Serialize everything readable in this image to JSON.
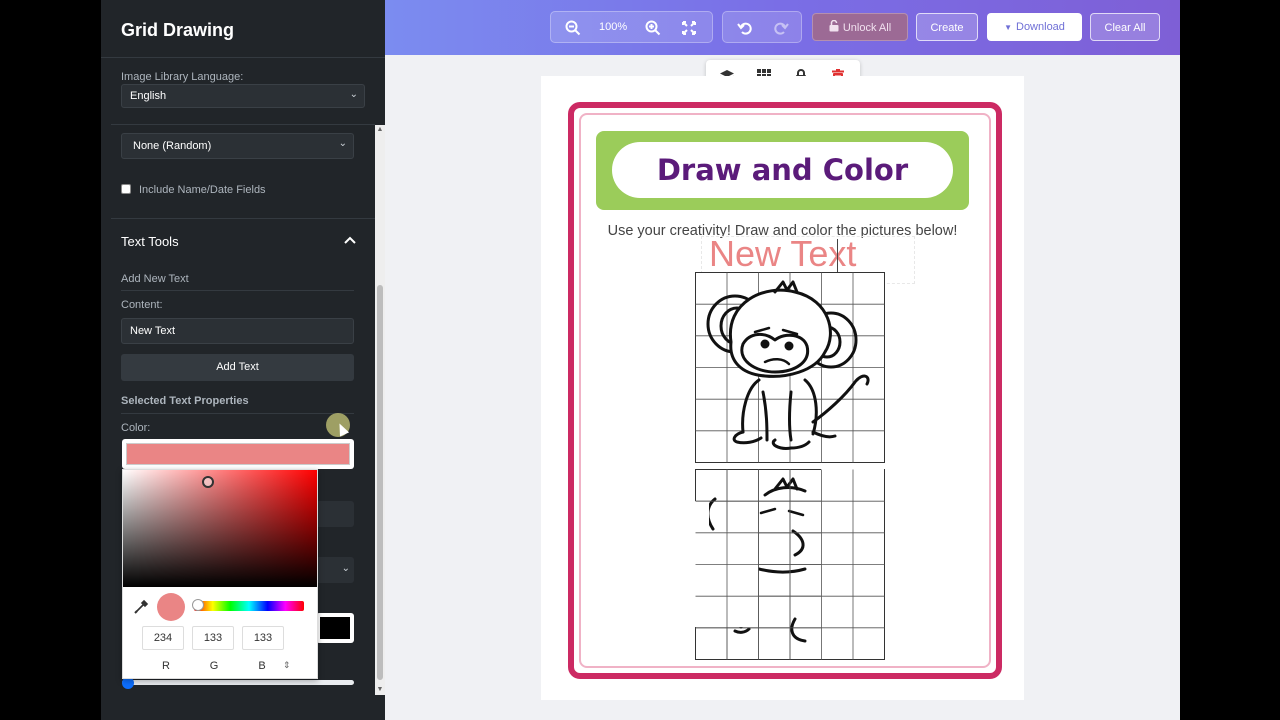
{
  "sidebar": {
    "title": "Grid Drawing",
    "language_label": "Image Library Language:",
    "language_value": "English",
    "category_value": "None (Random)",
    "include_fields_label": "Include Name/Date Fields",
    "text_tools_title": "Text Tools",
    "add_new_text_label": "Add New Text",
    "content_label": "Content:",
    "content_value": "New Text",
    "add_text_button": "Add Text",
    "selected_props_label": "Selected Text Properties",
    "color_label": "Color:",
    "color_value": "#ea8585"
  },
  "color_picker": {
    "r": "234",
    "g": "133",
    "b": "133",
    "r_label": "R",
    "g_label": "G",
    "b_label": "B",
    "mode_toggle": "⇕"
  },
  "toolbar": {
    "zoom": "100%",
    "unlock_all": "Unlock All",
    "create": "Create",
    "download": "Download",
    "clear_all": "Clear All"
  },
  "worksheet": {
    "title": "Draw and Color",
    "subtitle": "Use your creativity! Draw and color the pictures below!",
    "added_text": "New Text",
    "frame_color": "#cc2a63",
    "banner_color": "#9bcc5a",
    "title_color": "#5b1b7a",
    "grid_rows": 6,
    "grid_cols": 6
  }
}
